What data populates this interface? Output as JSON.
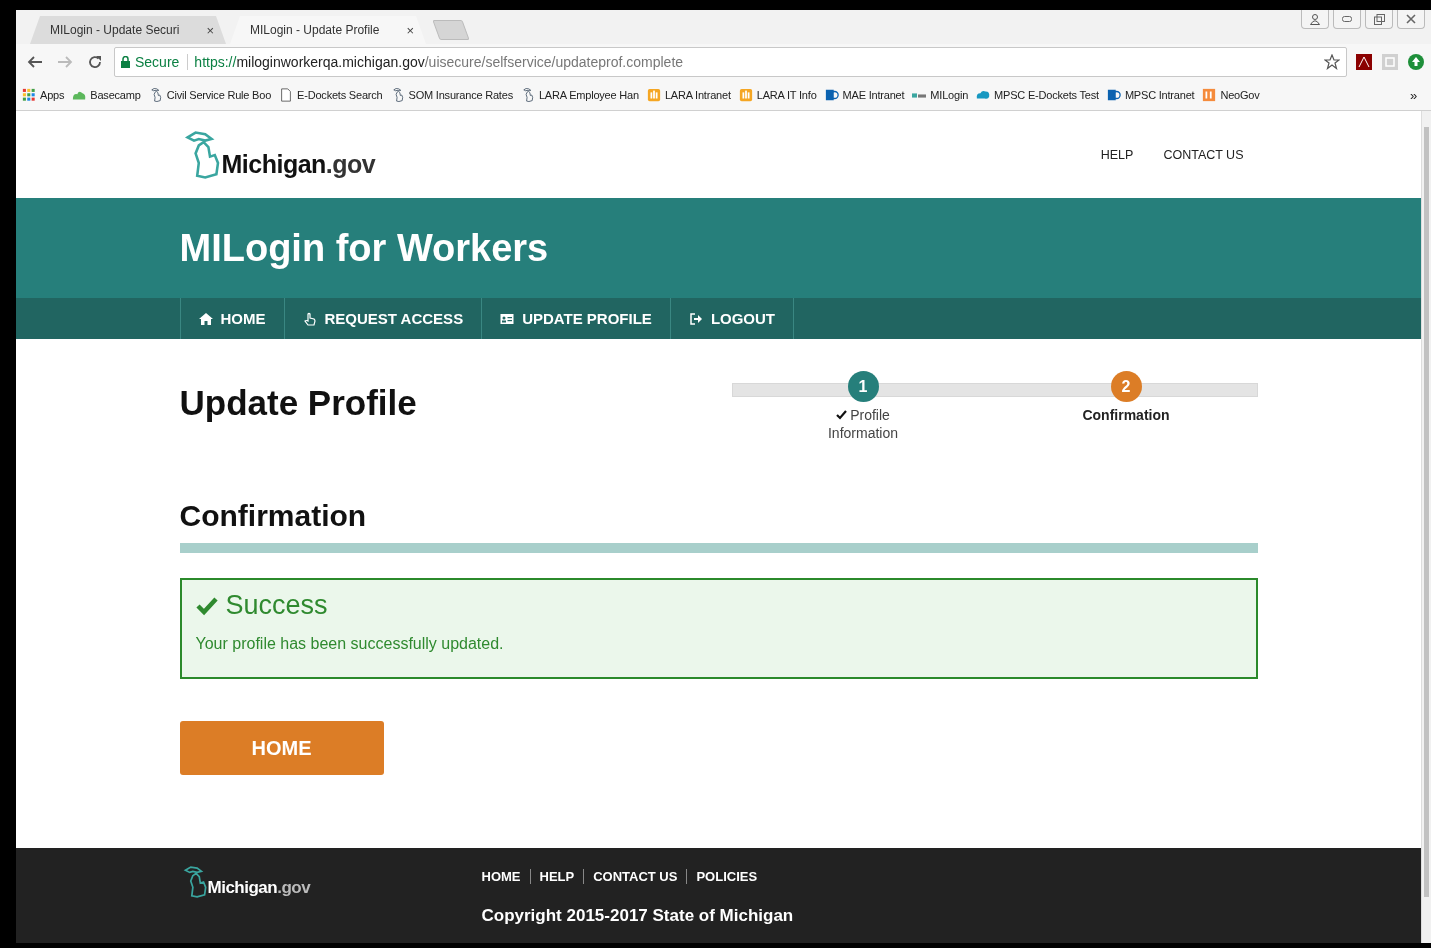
{
  "browser": {
    "tabs": [
      {
        "title": "MILogin - Update Securi",
        "selected": false
      },
      {
        "title": "MILogin - Update Profile",
        "selected": true
      }
    ],
    "address": {
      "secure_label": "Secure",
      "scheme": "https://",
      "host": "miloginworkerqa.michigan.gov",
      "path": "/uisecure/selfservice/updateprof.complete"
    },
    "bookmarks": [
      {
        "label": "Apps",
        "kind": "apps"
      },
      {
        "label": "Basecamp",
        "kind": "cloud"
      },
      {
        "label": "Civil Service Rule Boo",
        "kind": "state"
      },
      {
        "label": "E-Dockets Search",
        "kind": "page"
      },
      {
        "label": "SOM Insurance Rates",
        "kind": "state"
      },
      {
        "label": "LARA Employee Han",
        "kind": "state"
      },
      {
        "label": "LARA Intranet",
        "kind": "lara"
      },
      {
        "label": "LARA IT Info",
        "kind": "lara"
      },
      {
        "label": "MAE Intranet",
        "kind": "sharepoint"
      },
      {
        "label": "MILogin",
        "kind": "milogin"
      },
      {
        "label": "MPSC E-Dockets Test",
        "kind": "bluecloud"
      },
      {
        "label": "MPSC Intranet",
        "kind": "sharepoint"
      },
      {
        "label": "NeoGov",
        "kind": "pe"
      }
    ],
    "tab_close": "×",
    "more": "»"
  },
  "header": {
    "logo": {
      "name": "Michigan",
      "suffix": ".gov"
    },
    "links": [
      "HELP",
      "CONTACT US"
    ]
  },
  "banner": {
    "title": "MILogin for Workers"
  },
  "nav": [
    {
      "label": "HOME",
      "kind": "home"
    },
    {
      "label": "REQUEST ACCESS",
      "kind": "hand"
    },
    {
      "label": "UPDATE PROFILE",
      "kind": "card"
    },
    {
      "label": "LOGOUT",
      "kind": "logout"
    }
  ],
  "page_title": "Update Profile",
  "steps": [
    {
      "number": "1",
      "label": "Profile Information",
      "completed": true,
      "current": false
    },
    {
      "number": "2",
      "label": "Confirmation",
      "completed": false,
      "current": true
    }
  ],
  "section_title": "Confirmation",
  "alert": {
    "title": "Success",
    "message": "Your profile has been successfully updated."
  },
  "home_button": "HOME",
  "footer": {
    "logo": {
      "name": "Michigan",
      "suffix": ".gov"
    },
    "links": [
      "HOME",
      "HELP",
      "CONTACT US",
      "POLICIES"
    ],
    "copyright": "Copyright 2015-2017 State of Michigan"
  }
}
